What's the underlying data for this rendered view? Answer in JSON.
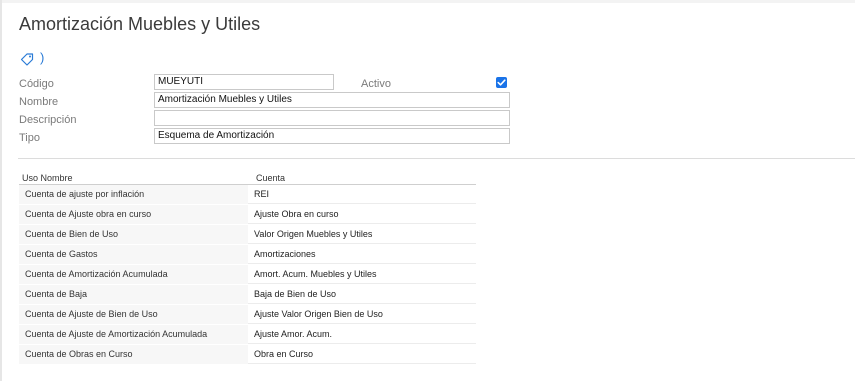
{
  "page": {
    "title": "Amortización Muebles y Utiles"
  },
  "form": {
    "codigo_label": "Código",
    "codigo_value": "MUEYUTI",
    "activo_label": "Activo",
    "activo_checked": true,
    "nombre_label": "Nombre",
    "nombre_value": "Amortización Muebles y Utiles",
    "descripcion_label": "Descripción",
    "descripcion_value": "",
    "tipo_label": "Tipo",
    "tipo_value": "Esquema de Amortización"
  },
  "table": {
    "headers": {
      "uso_nombre": "Uso Nombre",
      "cuenta": "Cuenta"
    },
    "rows": [
      {
        "uso": "Cuenta de ajuste por inflación",
        "cuenta": "REI"
      },
      {
        "uso": "Cuenta de Ajuste obra en curso",
        "cuenta": "Ajuste Obra en curso"
      },
      {
        "uso": "Cuenta de Bien de Uso",
        "cuenta": "Valor Origen Muebles y Utiles"
      },
      {
        "uso": "Cuenta de Gastos",
        "cuenta": "Amortizaciones"
      },
      {
        "uso": "Cuenta de Amortización Acumulada",
        "cuenta": "Amort. Acum. Muebles y Utiles"
      },
      {
        "uso": "Cuenta de Baja",
        "cuenta": "Baja de Bien de Uso"
      },
      {
        "uso": "Cuenta de Ajuste de Bien de Uso",
        "cuenta": "Ajuste Valor Origen Bien de Uso"
      },
      {
        "uso": "Cuenta de Ajuste de Amortización Acumulada",
        "cuenta": "Ajuste Amor. Acum."
      },
      {
        "uso": "Cuenta de Obras en Curso",
        "cuenta": "Obra en Curso"
      }
    ]
  },
  "icons": {
    "tag": "tag-icon",
    "chevron": "chevron-right-icon",
    "check": "check-icon"
  },
  "colors": {
    "accent": "#1a73e8",
    "link": "#2a7bd6"
  }
}
